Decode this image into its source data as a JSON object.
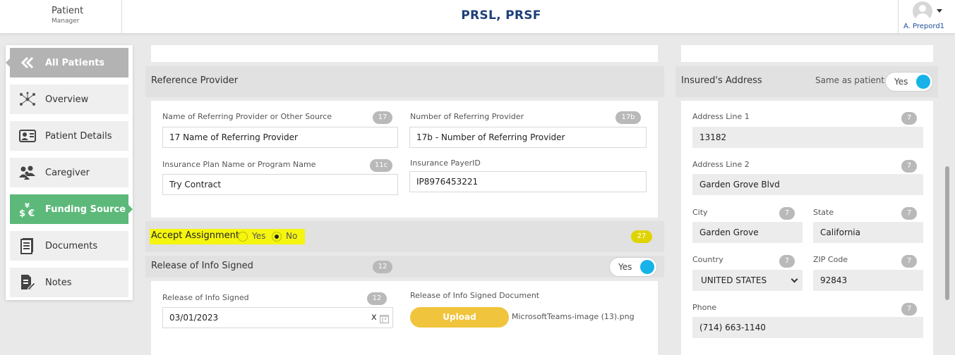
{
  "header": {
    "app_name": "Patient",
    "app_sub": "Manager",
    "page_title": "PRSL, PRSF",
    "user_name": "A. Prepord1"
  },
  "sidebar": {
    "items": [
      {
        "label": "All Patients",
        "icon": "double-chevron-left-icon"
      },
      {
        "label": "Overview",
        "icon": "network-icon"
      },
      {
        "label": "Patient Details",
        "icon": "id-card-icon"
      },
      {
        "label": "Caregiver",
        "icon": "people-icon"
      },
      {
        "label": "Funding Source",
        "icon": "currency-icon",
        "active": true
      },
      {
        "label": "Documents",
        "icon": "document-icon"
      },
      {
        "label": "Notes",
        "icon": "note-edit-icon"
      }
    ]
  },
  "reference_provider": {
    "title": "Reference Provider",
    "name_label": "Name of Referring Provider or Other Source",
    "name_badge": "17",
    "name_value": "17 Name of Referring Provider",
    "number_label": "Number of Referring Provider",
    "number_badge": "17b",
    "number_value": "17b - Number of Referring Provider",
    "plan_label": "Insurance Plan Name or Program Name",
    "plan_badge": "11c",
    "plan_value": "Try Contract",
    "payer_label": "Insurance PayerID",
    "payer_value": "IP8976453221"
  },
  "accept_assignment": {
    "label": "Accept Assignment",
    "yes": "Yes",
    "no": "No",
    "selected": "No",
    "badge": "27"
  },
  "release_info": {
    "title": "Release of Info Signed",
    "badge": "12",
    "toggle": "Yes",
    "date_label": "Release of Info Signed",
    "date_badge": "12",
    "date_value": "03/01/2023",
    "clear": "x",
    "doc_label": "Release of Info Signed Document",
    "upload": "Upload",
    "file_name": "MicrosoftTeams-image (13).png"
  },
  "insured_address": {
    "title": "Insured's Address",
    "same_as": "Same as patient",
    "toggle": "Yes",
    "line1_label": "Address Line 1",
    "line1_badge": "7",
    "line1_value": "13182",
    "line2_label": "Address Line 2",
    "line2_badge": "7",
    "line2_value": "Garden Grove Blvd",
    "city_label": "City",
    "city_badge": "7",
    "city_value": "Garden Grove",
    "state_label": "State",
    "state_badge": "7",
    "state_value": "California",
    "country_label": "Country",
    "country_badge": "7",
    "country_value": "UNITED STATES",
    "zip_label": "ZIP Code",
    "zip_badge": "7",
    "zip_value": "92843",
    "phone_label": "Phone",
    "phone_badge": "7",
    "phone_value": "(714) 663-1140"
  },
  "colors": {
    "accent_green": "#5cb979",
    "title_blue": "#1f3f7a",
    "toggle_blue": "#17b3e8",
    "upload_yellow": "#f0c43c",
    "highlight": "#f5f50f"
  }
}
